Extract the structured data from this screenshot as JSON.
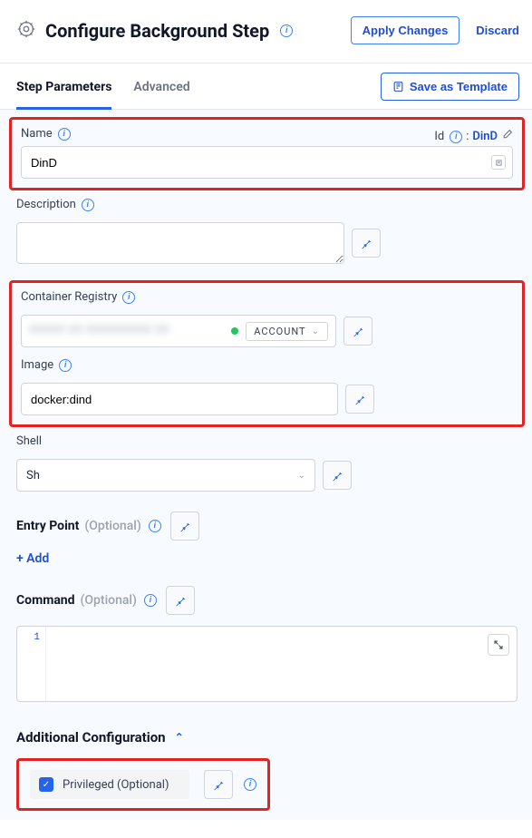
{
  "header": {
    "title": "Configure Background Step",
    "apply_label": "Apply Changes",
    "discard_label": "Discard"
  },
  "tabs": {
    "parameters": "Step Parameters",
    "advanced": "Advanced",
    "save_template": "Save as Template"
  },
  "name": {
    "label": "Name",
    "value": "DinD",
    "id_prefix": "Id",
    "id_value": "DinD"
  },
  "description": {
    "label": "Description",
    "value": ""
  },
  "registry": {
    "label": "Container Registry",
    "masked": "XXXXX XX XXXXXXXXX XX",
    "scope": "ACCOUNT"
  },
  "image": {
    "label": "Image",
    "value": "docker:dind"
  },
  "shell": {
    "label": "Shell",
    "value": "Sh"
  },
  "entry_point": {
    "label": "Entry Point",
    "optional": "(Optional)",
    "add": "+ Add"
  },
  "command": {
    "label": "Command",
    "optional": "(Optional)",
    "line_number": "1"
  },
  "accordion": {
    "label": "Additional Configuration"
  },
  "privileged": {
    "label": "Privileged (Optional)",
    "checked": true
  }
}
